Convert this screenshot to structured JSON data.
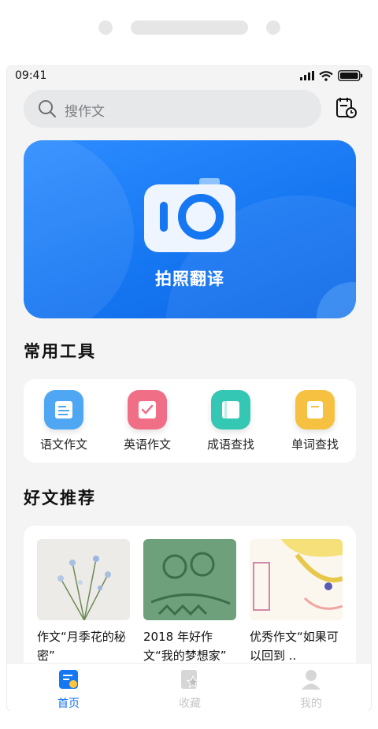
{
  "status": {
    "time": "09:41"
  },
  "search": {
    "placeholder": "搜作文"
  },
  "banner": {
    "title": "拍照翻译"
  },
  "tools_section": {
    "title": "常用工具",
    "items": [
      {
        "label": "语文作文",
        "icon": "chinese-essay-icon",
        "color": "#4fa7f3"
      },
      {
        "label": "英语作文",
        "icon": "english-essay-icon",
        "color": "#f06f86"
      },
      {
        "label": "成语查找",
        "icon": "idiom-search-icon",
        "color": "#34c7b4"
      },
      {
        "label": "单词查找",
        "icon": "word-search-icon",
        "color": "#f6c140"
      }
    ]
  },
  "articles_section": {
    "title": "好文推荐",
    "items": [
      {
        "title": "作文“月季花的秘密”"
      },
      {
        "title": "2018 年好作文“我的梦想家”"
      },
      {
        "title": "优秀作文“如果可以回到 .."
      }
    ]
  },
  "tabbar": {
    "items": [
      {
        "label": "首页",
        "active": true
      },
      {
        "label": "收藏",
        "active": false
      },
      {
        "label": "我的",
        "active": false
      }
    ]
  },
  "colors": {
    "accent": "#1677f2",
    "tab_active": "#1677f2",
    "tab_inactive": "#c8c8c8"
  }
}
